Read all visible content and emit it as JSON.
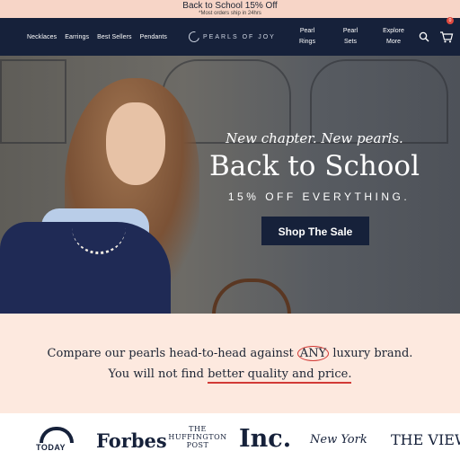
{
  "promo": {
    "title": "Back to School 15% Off",
    "subtitle": "*Most orders ship in 24hrs"
  },
  "header": {
    "nav_left": [
      "Necklaces",
      "Earrings",
      "Best Sellers",
      "Pendants"
    ],
    "logo_text": "PEARLS OF JOY",
    "nav_right": [
      {
        "line1": "Pearl",
        "line2": "Rings"
      },
      {
        "line1": "Pearl",
        "line2": "Sets"
      },
      {
        "line1": "Explore",
        "line2": "More"
      }
    ],
    "cart_count": "0",
    "icons": {
      "search": "search-icon",
      "cart": "cart-icon"
    }
  },
  "hero": {
    "tagline": "New chapter. New pearls.",
    "title": "Back to School",
    "subtitle": "15% OFF EVERYTHING.",
    "cta_label": "Shop The Sale"
  },
  "compare": {
    "line1_before": "Compare our pearls head-to-head against",
    "line1_circled": "ANY",
    "line1_after": "luxury brand.",
    "line2_before": "You will not find",
    "line2_underlined": "better quality and price."
  },
  "press": {
    "today": "TODAY",
    "forbes": "Forbes",
    "huffington_1": "THE",
    "huffington_2": "HUFFINGTON",
    "huffington_3": "POST",
    "inc": "Inc.",
    "newyork": "New York",
    "view": "THE VIEW"
  },
  "colors": {
    "navy": "#16213a",
    "promo_bg": "#f7d5c7",
    "compare_bg": "#fde9df",
    "accent_red": "#d23a36"
  }
}
